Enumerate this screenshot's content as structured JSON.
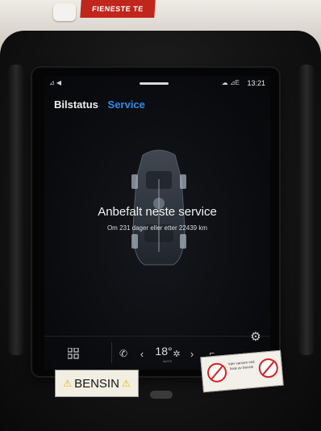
{
  "background": {
    "red_sign_text": "FIENESTE TE"
  },
  "screen": {
    "status_bar": {
      "time": "13:21",
      "left_icons": "⊿ ◀",
      "right_icons": "☁ ⊿E"
    },
    "tabs": [
      {
        "label": "Bilstatus",
        "active": false
      },
      {
        "label": "Service",
        "active": true
      }
    ],
    "service": {
      "title": "Anbefalt neste service",
      "subtitle": "Om 231 dager eller etter 22439 km"
    },
    "bottom_bar": {
      "temperature": "18°",
      "temperature_mode": "AUTO",
      "icons": [
        "apps-grid-icon",
        "phone-icon",
        "chevron-left-icon",
        "fan-icon",
        "chevron-right-icon",
        "seat-heater-icon",
        "settings-gear-icon"
      ]
    }
  },
  "stickers": {
    "fuel_label": "BENSIN",
    "warning_text": "Vær varsom ved bruk av bensin"
  },
  "colors": {
    "accent_blue": "#2b8cf0",
    "screen_bg": "#0a0b0e",
    "warning_yellow": "#e6b800",
    "prohibit_red": "#d82020"
  }
}
